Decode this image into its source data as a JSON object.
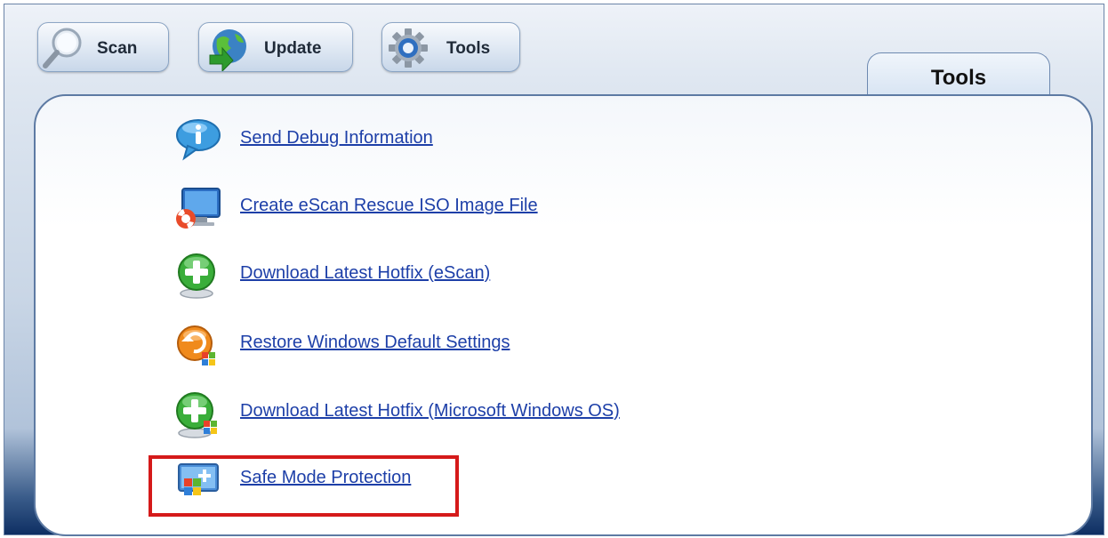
{
  "toolbar": {
    "scan_label": "Scan",
    "update_label": "Update",
    "tools_label": "Tools"
  },
  "tab": {
    "label": "Tools"
  },
  "tools": [
    {
      "label": "Send Debug Information",
      "icon": "info-bubble-icon"
    },
    {
      "label": "Create eScan Rescue ISO Image File",
      "icon": "rescue-monitor-icon"
    },
    {
      "label": "Download Latest Hotfix (eScan)",
      "icon": "green-plus-icon"
    },
    {
      "label": "Restore Windows Default Settings",
      "icon": "restore-windows-icon"
    },
    {
      "label": "Download Latest Hotfix (Microsoft Windows OS)",
      "icon": "green-plus-windows-icon"
    },
    {
      "label": "Safe Mode Protection",
      "icon": "safe-mode-windows-icon"
    }
  ],
  "colors": {
    "link": "#1d3fa8",
    "highlight_border": "#d51a1a",
    "panel_border": "#5d7aa3"
  }
}
